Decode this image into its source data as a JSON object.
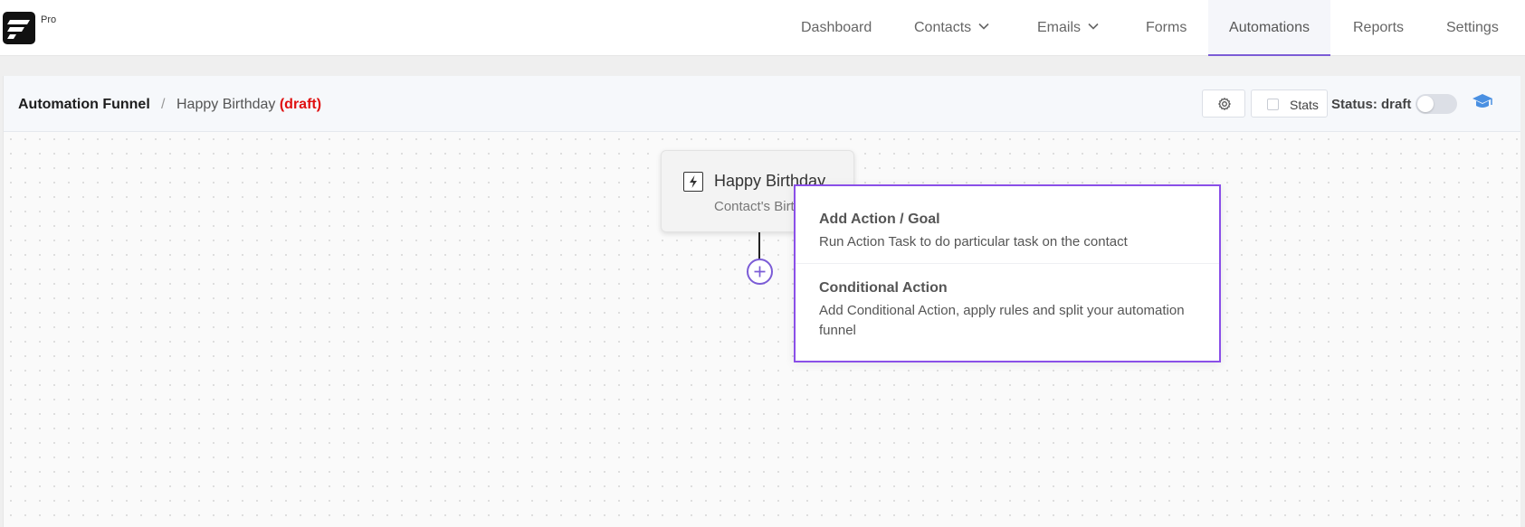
{
  "brand": {
    "badge": "Pro"
  },
  "nav": {
    "items": [
      {
        "label": "Dashboard"
      },
      {
        "label": "Contacts"
      },
      {
        "label": "Emails"
      },
      {
        "label": "Forms"
      },
      {
        "label": "Automations"
      },
      {
        "label": "Reports"
      },
      {
        "label": "Settings"
      }
    ],
    "active": "Automations"
  },
  "header": {
    "root": "Automation Funnel",
    "separator": "/",
    "funnel_name": "Happy Birthday",
    "funnel_state": "(draft)",
    "stats_label": "Stats",
    "status_label": "Status: draft",
    "status_enabled": false
  },
  "trigger": {
    "title": "Happy Birthday",
    "subtitle": "Contact's Birthday"
  },
  "menu": {
    "items": [
      {
        "title": "Add Action / Goal",
        "description": "Run Action Task to do particular task on the contact"
      },
      {
        "title": "Conditional Action",
        "description": "Add Conditional Action, apply rules and split your automation funnel"
      }
    ]
  },
  "colors": {
    "accent": "#7b5cd6",
    "menu_border": "#8a4fe8",
    "draft": "#e01010",
    "grad_icon": "#4a90e2"
  },
  "icons": [
    "logo-icon",
    "chevron-down-icon",
    "gear-icon",
    "checkbox-icon",
    "toggle-switch",
    "graduation-cap-icon",
    "lightning-bolt-icon",
    "plus-icon"
  ]
}
